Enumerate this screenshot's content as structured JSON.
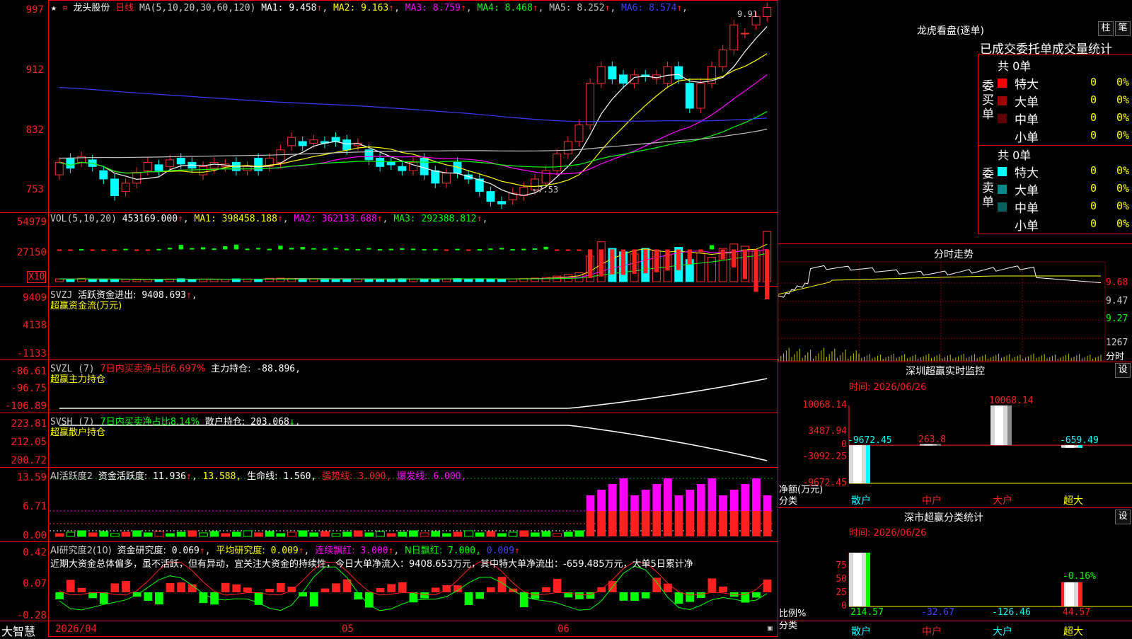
{
  "stock": {
    "name": "龙头股份",
    "period": "日线",
    "star": "★",
    "pin": "¤"
  },
  "ma_line": {
    "prefix": "MA(5,10,20,30,60,120)",
    "items": [
      {
        "label": "MA1:",
        "value": "9.458",
        "arrow": "↑",
        "color": "#ffffff"
      },
      {
        "label": "MA2:",
        "value": "9.163",
        "arrow": "↑",
        "color": "#ffff00"
      },
      {
        "label": "MA3:",
        "value": "8.759",
        "arrow": "↑",
        "color": "#ff00ff"
      },
      {
        "label": "MA4:",
        "value": "8.468",
        "arrow": "↑",
        "color": "#00ff00"
      },
      {
        "label": "MA5:",
        "value": "8.252",
        "arrow": "↑",
        "color": "#c0c0c0"
      },
      {
        "label": "MA6:",
        "value": "8.574",
        "arrow": "↑",
        "color": "#4040ff"
      }
    ]
  },
  "price_axis": [
    "997",
    "912",
    "832",
    "753"
  ],
  "price_high_label": "9.91",
  "price_low_label": "←7.53",
  "vol": {
    "header": "VOL(5,10,20)",
    "value": "453169.000",
    "items": [
      {
        "label": "MA1:",
        "value": "398458.188",
        "color": "#ffff00"
      },
      {
        "label": "MA2:",
        "value": "362133.688",
        "color": "#ff00ff"
      },
      {
        "label": "MA3:",
        "value": "292388.812",
        "color": "#00ff00"
      }
    ],
    "axis": [
      "54979",
      "27150"
    ],
    "unit_box": "X10"
  },
  "svzj": {
    "header": "SVZJ",
    "title": "活跃资金进出:",
    "value": "9408.693",
    "subtitle": "超赢资金流(万元)",
    "axis": [
      "9409",
      "4138",
      "-1133"
    ]
  },
  "svzl": {
    "header": "SVZL (7)",
    "info": "7日内买卖净占比6.697%",
    "title": "主力持仓:",
    "value": "-88.896",
    "subtitle": "超赢主力持仓",
    "axis": [
      "-86.61",
      "-96.75",
      "-106.89"
    ]
  },
  "svsh": {
    "header": "SVSH (7)",
    "info": "7日内买卖净占比8.14%",
    "title": "散户持仓:",
    "value": "203.068",
    "subtitle": "超赢散户持仓",
    "axis": [
      "223.81",
      "212.05",
      "200.72"
    ]
  },
  "ai_active": {
    "header": "AI活跃度2",
    "title": "资金活跃度:",
    "value": "11.936",
    "v2": "13.588,",
    "life_label": "生命线:",
    "life_value": "1.560,",
    "strong_label": "强势线:",
    "strong_value": "3.000,",
    "burst_label": "爆发线:",
    "burst_value": "6.000,",
    "axis": [
      "13.59",
      "6.71",
      "0.00"
    ]
  },
  "ai_research": {
    "header": "AI研究度2(10)",
    "title": "资金研究度:",
    "value": "0.069",
    "avg_label": "平均研究度:",
    "avg_value": "0.009",
    "red_label": "连续飘红:",
    "red_value": "3.000",
    "nred_label": "N日飘红:",
    "nred_value": "7.000,",
    "last_value": "0.009",
    "comment": "近期大资金总体偏多，虽不活跃，但有异动，宜关注大资金的持续性，今日大单净流入：9408.653万元，其中特大单净流出：-659.485万元，大单5日累计净",
    "axis": [
      "0.42",
      "0.07",
      "-0.28"
    ]
  },
  "date_axis": [
    "2026/04",
    "05",
    "06"
  ],
  "brand": "大智慧",
  "lhb": {
    "title": "龙虎看盘(逐单)",
    "btn_bar": "柱",
    "btn_pen": "笔",
    "tabs": [
      "已成交",
      "委托单",
      "成交量统计"
    ],
    "buy": {
      "side": "委买单",
      "total": "共 0单",
      "rows": [
        {
          "name": "特大",
          "count": "0",
          "pct": "0%",
          "color": "#ff0000"
        },
        {
          "name": "大单",
          "count": "0",
          "pct": "0%",
          "color": "#a00000"
        },
        {
          "name": "中单",
          "count": "0",
          "pct": "0%",
          "color": "#600000"
        },
        {
          "name": "小单",
          "count": "0",
          "pct": "0%",
          "color": "#000000"
        }
      ]
    },
    "sell": {
      "side": "委卖单",
      "total": "共 0单",
      "rows": [
        {
          "name": "特大",
          "count": "0",
          "pct": "0%",
          "color": "#00ffff"
        },
        {
          "name": "大单",
          "count": "0",
          "pct": "0%",
          "color": "#008b8b"
        },
        {
          "name": "中单",
          "count": "0",
          "pct": "0%",
          "color": "#006060"
        },
        {
          "name": "小单",
          "count": "0",
          "pct": "0%",
          "color": "#000000"
        }
      ]
    }
  },
  "intraday": {
    "title": "分时走势",
    "axis": [
      "9.68",
      "9.47",
      "9.27"
    ],
    "vol_label": "1267",
    "bottom_label": "分时"
  },
  "monitor": {
    "title": "深圳超赢实时监控",
    "settings": "设",
    "time_label": "时间: 2026/06/26",
    "axis": [
      "10068.14",
      "3487.94",
      "0",
      "-3092.25",
      "-9672.45"
    ],
    "bars": [
      {
        "category": "散户",
        "value": -9672.45,
        "label": "-9672.45"
      },
      {
        "category": "中户",
        "value": 263.8,
        "label": "263.8"
      },
      {
        "category": "大户",
        "value": 10068.14,
        "label": "10068.14"
      },
      {
        "category": "超大",
        "value": -659.49,
        "label": "-659.49"
      }
    ],
    "ylabel": "净额(万元)",
    "xlabel": "分类"
  },
  "classify": {
    "title": "深市超赢分类统计",
    "settings": "设",
    "time_label": "时间: 2026/06/26",
    "axis": [
      "75",
      "50",
      "25",
      "0"
    ],
    "bars": [
      {
        "category": "散户",
        "value": 214.57,
        "label": "214.57"
      },
      {
        "category": "中户",
        "value": -32.67,
        "label": "-32.67"
      },
      {
        "category": "大户",
        "value": -126.46,
        "label": "-126.46"
      },
      {
        "category": "超大",
        "value": 44.57,
        "label": "44.57",
        "top_label": "-0.16%"
      }
    ],
    "ylabel": "比例%",
    "xlabel": "分类"
  },
  "chart_data": [
    {
      "type": "candlestick",
      "title": "龙头股份 日线",
      "ylim": [
        7.45,
        10.0
      ],
      "x_ticks": [
        "2026/04",
        "05",
        "06"
      ],
      "open": [
        7.9,
        8.1,
        8.05,
        8.08,
        7.95,
        7.85,
        7.7,
        7.8,
        7.95,
        8.02,
        8.0,
        8.1,
        8.05,
        7.9,
        7.98,
        8.0,
        8.05,
        7.95,
        8.1,
        8.0,
        8.05,
        8.25,
        8.3,
        8.28,
        8.3,
        8.35,
        8.32,
        8.25,
        8.2,
        8.1,
        8.05,
        8.0,
        7.95,
        8.1,
        7.95,
        7.8,
        8.05,
        7.9,
        7.85,
        7.7,
        7.58,
        7.6,
        7.65,
        7.72,
        7.8,
        7.95,
        8.15,
        8.3,
        8.5,
        9.0,
        9.2,
        9.1,
        9.0,
        9.1,
        9.05,
        9.0,
        9.2,
        9.0,
        8.7,
        9.0,
        9.2,
        9.4,
        9.6,
        9.7,
        9.8
      ],
      "close": [
        8.05,
        7.98,
        8.12,
        8.0,
        7.85,
        7.65,
        7.8,
        7.93,
        8.05,
        7.95,
        8.08,
        8.03,
        7.98,
        8.0,
        8.05,
        8.03,
        7.95,
        8.0,
        7.95,
        8.1,
        8.2,
        8.35,
        8.25,
        8.32,
        8.28,
        8.3,
        8.2,
        8.28,
        8.08,
        8.0,
        8.02,
        7.95,
        8.05,
        7.9,
        7.8,
        7.92,
        7.92,
        7.85,
        7.7,
        7.58,
        7.55,
        7.68,
        7.75,
        7.85,
        7.95,
        8.15,
        8.3,
        8.5,
        9.0,
        9.2,
        9.05,
        9.0,
        9.1,
        9.08,
        9.1,
        9.2,
        9.05,
        8.7,
        9.0,
        9.2,
        9.4,
        9.7,
        9.6,
        9.8,
        9.91
      ]
    },
    {
      "type": "bar",
      "title": "VOL(5,10,20)",
      "ylim": [
        0,
        55000
      ],
      "values": [
        2500,
        2200,
        3000,
        2100,
        1900,
        2300,
        2000,
        1800,
        2000,
        2100,
        2400,
        2600,
        2200,
        2300,
        2000,
        2100,
        2500,
        2400,
        2200,
        3000,
        3100,
        2600,
        2800,
        2400,
        2700,
        2500,
        2600,
        2300,
        2400,
        2200,
        2500,
        2700,
        2400,
        2600,
        2300,
        2500,
        2800,
        2600,
        2700,
        2500,
        2300,
        2600,
        2900,
        3200,
        3800,
        5000,
        6500,
        8000,
        23000,
        36000,
        30000,
        27000,
        25000,
        30000,
        28000,
        24000,
        31000,
        20000,
        26000,
        22000,
        30000,
        34000,
        32000,
        28000,
        45300
      ]
    },
    {
      "type": "bar",
      "title": "活跃资金进出",
      "ylim": [
        -1133,
        9409
      ],
      "values": [
        0,
        120,
        -80,
        0,
        150,
        90,
        -120,
        80,
        0,
        -100,
        -300,
        -850,
        -250,
        -400,
        -180,
        -600,
        -900,
        -150,
        -280,
        -120,
        -700,
        -300,
        -460,
        -240,
        -160,
        -300,
        -120,
        -90,
        -250,
        -80,
        -120,
        -200,
        -150,
        -80,
        -100,
        0,
        -120,
        0,
        -60,
        -180,
        -300,
        -80,
        -120,
        -200,
        -500,
        200,
        150,
        120,
        5400,
        5100,
        4700,
        4800,
        4600,
        4500,
        4300,
        4000,
        3900,
        2800,
        500,
        -800,
        1900,
        3400,
        5600,
        8000,
        9409
      ]
    }
  ]
}
